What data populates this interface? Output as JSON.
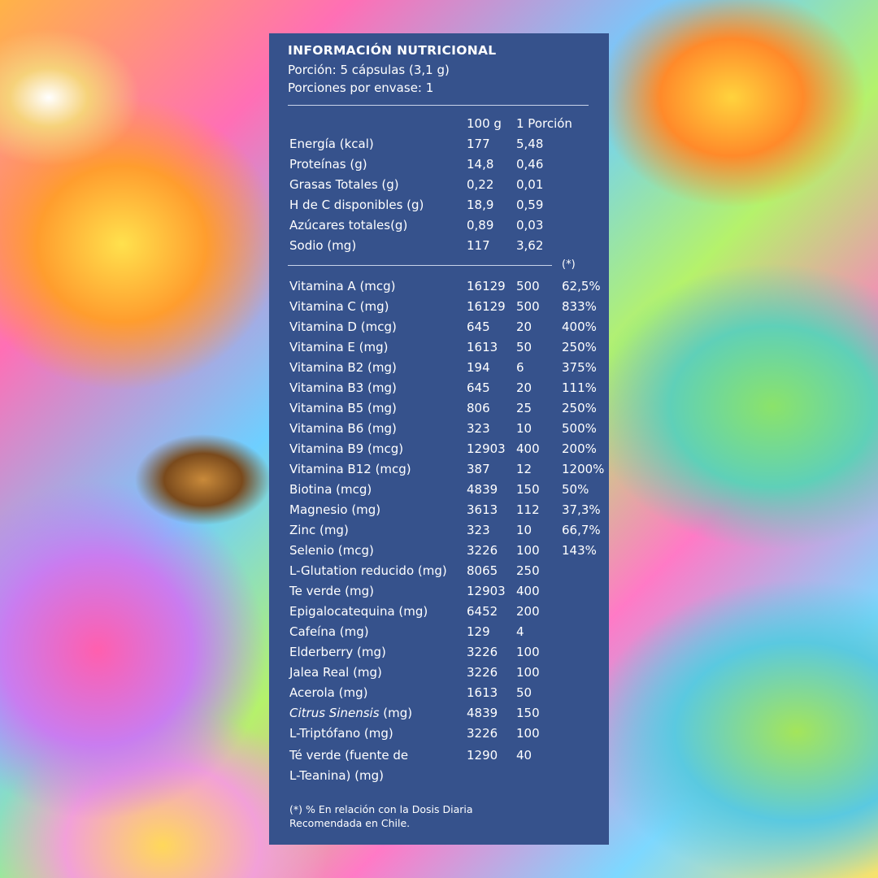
{
  "title": "INFORMACIÓN NUTRICIONAL",
  "serving": "Porción: 5 cápsulas (3,1 g)",
  "servings_per_container": "Porciones por envase: 1",
  "columns": {
    "per100": "100 g",
    "per_portion": "1 Porción",
    "pct": "(*)"
  },
  "nutrients": [
    {
      "name": "Energía (kcal)",
      "g100": "177",
      "portion": "5,48"
    },
    {
      "name": "Proteínas (g)",
      "g100": "14,8",
      "portion": "0,46"
    },
    {
      "name": "Grasas Totales (g)",
      "g100": "0,22",
      "portion": "0,01"
    },
    {
      "name": "H de C disponibles (g)",
      "g100": "18,9",
      "portion": "0,59"
    },
    {
      "name": "Azúcares totales(g)",
      "g100": "0,89",
      "portion": "0,03"
    },
    {
      "name": "Sodio (mg)",
      "g100": "117",
      "portion": "3,62"
    }
  ],
  "vitamins": [
    {
      "name": "Vitamina A (mcg)",
      "g100": "16129",
      "portion": "500",
      "pct": "62,5%"
    },
    {
      "name": "Vitamina C (mg)",
      "g100": "16129",
      "portion": "500",
      "pct": "833%"
    },
    {
      "name": "Vitamina D (mcg)",
      "g100": "645",
      "portion": "20",
      "pct": "400%"
    },
    {
      "name": "Vitamina E (mg)",
      "g100": "1613",
      "portion": "50",
      "pct": "250%"
    },
    {
      "name": "Vitamina B2 (mg)",
      "g100": "194",
      "portion": "6",
      "pct": "375%"
    },
    {
      "name": "Vitamina B3 (mg)",
      "g100": "645",
      "portion": "20",
      "pct": "111%"
    },
    {
      "name": "Vitamina B5 (mg)",
      "g100": "806",
      "portion": "25",
      "pct": "250%"
    },
    {
      "name": "Vitamina B6 (mg)",
      "g100": "323",
      "portion": "10",
      "pct": "500%"
    },
    {
      "name": "Vitamina B9 (mcg)",
      "g100": "12903",
      "portion": "400",
      "pct": "200%"
    },
    {
      "name": "Vitamina B12 (mcg)",
      "g100": "387",
      "portion": "12",
      "pct": "1200%"
    },
    {
      "name": "Biotina (mcg)",
      "g100": "4839",
      "portion": "150",
      "pct": "50%"
    },
    {
      "name": "Magnesio (mg)",
      "g100": "3613",
      "portion": "112",
      "pct": "37,3%"
    },
    {
      "name": "Zinc (mg)",
      "g100": "323",
      "portion": "10",
      "pct": "66,7%"
    },
    {
      "name": "Selenio (mcg)",
      "g100": "3226",
      "portion": "100",
      "pct": "143%"
    },
    {
      "name": "L-Glutation reducido (mg)",
      "g100": "8065",
      "portion": "250",
      "pct": ""
    },
    {
      "name": "Te verde (mg)",
      "g100": "12903",
      "portion": "400",
      "pct": ""
    },
    {
      "name": "Epigalocatequina (mg)",
      "g100": "6452",
      "portion": "200",
      "pct": ""
    },
    {
      "name": "Cafeína (mg)",
      "g100": "129",
      "portion": "4",
      "pct": ""
    },
    {
      "name": "Elderberry (mg)",
      "g100": "3226",
      "portion": "100",
      "pct": ""
    },
    {
      "name": "Jalea Real (mg)",
      "g100": "3226",
      "portion": "100",
      "pct": ""
    },
    {
      "name": "Acerola (mg)",
      "g100": "1613",
      "portion": "50",
      "pct": ""
    },
    {
      "name_italic": "Citrus Sinensis",
      "name_suffix": " (mg)",
      "g100": "4839",
      "portion": "150",
      "pct": ""
    },
    {
      "name": "L-Triptófano (mg)",
      "g100": "3226",
      "portion": "100",
      "pct": ""
    }
  ],
  "last_item": {
    "line1": "Té verde (fuente de",
    "line2": "L-Teanina) (mg)",
    "g100": "1290",
    "portion": "40"
  },
  "footnote_line1": "(*) % En relación con la Dosis Diaria",
  "footnote_line2": "Recomendada en Chile."
}
